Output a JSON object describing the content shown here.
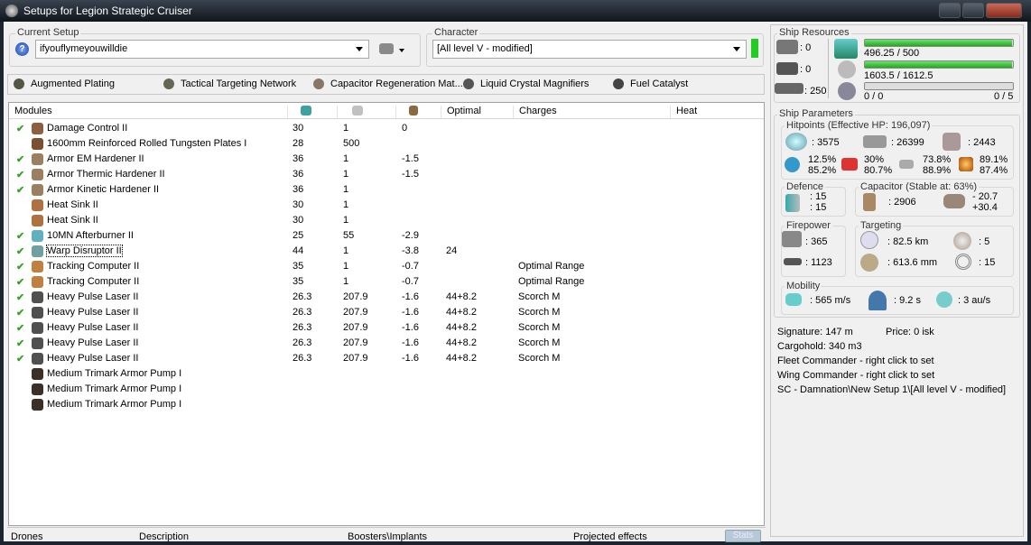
{
  "window": {
    "title": "Setups for Legion Strategic Cruiser"
  },
  "setup": {
    "label": "Current Setup",
    "value": "ifyouflymeyouwilldie"
  },
  "character": {
    "label": "Character",
    "value": "[All level V - modified]",
    "status_color": "#22cc22"
  },
  "subsystems": [
    "Augmented Plating",
    "Tactical Targeting Network",
    "Capacitor Regeneration Mat...",
    "Liquid Crystal Magnifiers",
    "Fuel Catalyst"
  ],
  "modules": {
    "headers": {
      "name": "Modules",
      "optimal": "Optimal",
      "charges": "Charges",
      "heat": "Heat"
    },
    "rows": [
      {
        "on": true,
        "name": "Damage Control II",
        "cpu": "30",
        "pg": "1",
        "cap": "0",
        "optimal": "",
        "charge": "",
        "icon": "#8a6040"
      },
      {
        "on": false,
        "name": "1600mm Reinforced Rolled Tungsten Plates I",
        "cpu": "28",
        "pg": "500",
        "cap": "",
        "optimal": "",
        "charge": "",
        "icon": "#7a5030"
      },
      {
        "on": true,
        "name": "Armor EM Hardener II",
        "cpu": "36",
        "pg": "1",
        "cap": "-1.5",
        "optimal": "",
        "charge": "",
        "icon": "#9a8060"
      },
      {
        "on": true,
        "name": "Armor Thermic Hardener II",
        "cpu": "36",
        "pg": "1",
        "cap": "-1.5",
        "optimal": "",
        "charge": "",
        "icon": "#9a8060"
      },
      {
        "on": true,
        "name": "Armor Kinetic Hardener II",
        "cpu": "36",
        "pg": "1",
        "cap": "",
        "optimal": "",
        "charge": "",
        "icon": "#9a8060"
      },
      {
        "on": false,
        "name": "Heat Sink II",
        "cpu": "30",
        "pg": "1",
        "cap": "",
        "optimal": "",
        "charge": "",
        "icon": "#b07040"
      },
      {
        "on": false,
        "name": "Heat Sink II",
        "cpu": "30",
        "pg": "1",
        "cap": "",
        "optimal": "",
        "charge": "",
        "icon": "#b07040"
      },
      {
        "on": true,
        "name": "10MN Afterburner II",
        "cpu": "25",
        "pg": "55",
        "cap": "-2.9",
        "optimal": "",
        "charge": "",
        "icon": "#60b0c0"
      },
      {
        "on": true,
        "name": "Warp Disruptor II",
        "cpu": "44",
        "pg": "1",
        "cap": "-3.8",
        "optimal": "24",
        "charge": "",
        "icon": "#70a0a0"
      },
      {
        "on": true,
        "name": "Tracking Computer II",
        "cpu": "35",
        "pg": "1",
        "cap": "-0.7",
        "optimal": "",
        "charge": "Optimal Range",
        "icon": "#c08040"
      },
      {
        "on": true,
        "name": "Tracking Computer II",
        "cpu": "35",
        "pg": "1",
        "cap": "-0.7",
        "optimal": "",
        "charge": "Optimal Range",
        "icon": "#c08040"
      },
      {
        "on": true,
        "name": "Heavy Pulse Laser II",
        "cpu": "26.3",
        "pg": "207.9",
        "cap": "-1.6",
        "optimal": "44+8.2",
        "charge": "Scorch M",
        "icon": "#505050"
      },
      {
        "on": true,
        "name": "Heavy Pulse Laser II",
        "cpu": "26.3",
        "pg": "207.9",
        "cap": "-1.6",
        "optimal": "44+8.2",
        "charge": "Scorch M",
        "icon": "#505050"
      },
      {
        "on": true,
        "name": "Heavy Pulse Laser II",
        "cpu": "26.3",
        "pg": "207.9",
        "cap": "-1.6",
        "optimal": "44+8.2",
        "charge": "Scorch M",
        "icon": "#505050"
      },
      {
        "on": true,
        "name": "Heavy Pulse Laser II",
        "cpu": "26.3",
        "pg": "207.9",
        "cap": "-1.6",
        "optimal": "44+8.2",
        "charge": "Scorch M",
        "icon": "#505050"
      },
      {
        "on": true,
        "name": "Heavy Pulse Laser II",
        "cpu": "26.3",
        "pg": "207.9",
        "cap": "-1.6",
        "optimal": "44+8.2",
        "charge": "Scorch M",
        "icon": "#505050"
      },
      {
        "on": false,
        "name": "Medium Trimark Armor Pump I",
        "cpu": "",
        "pg": "",
        "cap": "",
        "optimal": "",
        "charge": "",
        "icon": "#3a3028"
      },
      {
        "on": false,
        "name": "Medium Trimark Armor Pump I",
        "cpu": "",
        "pg": "",
        "cap": "",
        "optimal": "",
        "charge": "",
        "icon": "#3a3028"
      },
      {
        "on": false,
        "name": "Medium Trimark Armor Pump I",
        "cpu": "",
        "pg": "",
        "cap": "",
        "optimal": "",
        "charge": "",
        "icon": "#3a3028"
      }
    ]
  },
  "bottom_tabs": {
    "drones": "Drones",
    "description": "Description",
    "boosters": "Boosters\\Implants",
    "projected": "Projected effects",
    "stats": "Stats"
  },
  "resources": {
    "label": "Ship Resources",
    "turrets": ": 0",
    "launchers": ": 0",
    "drone_bay": ": 250",
    "cpu": {
      "text": "496.25 / 500",
      "fraction": 0.9925
    },
    "pg": {
      "text": "1603.5 / 1612.5",
      "fraction": 0.9944
    },
    "drone_bw": {
      "text": "0 / 0",
      "fraction": 0,
      "drones": "0 / 5"
    }
  },
  "params": {
    "label": "Ship Parameters",
    "hitpoints": {
      "label": "Hitpoints (Effective HP: 196,097)",
      "shield": ": 3575",
      "armor": ": 26399",
      "structure": ": 2443",
      "em": [
        "12.5%",
        "85.2%"
      ],
      "thermal": [
        "30%",
        "80.7%"
      ],
      "kinetic": [
        "73.8%",
        "88.9%"
      ],
      "explosive": [
        "89.1%",
        "87.4%"
      ]
    },
    "defence": {
      "label": "Defence",
      "a": ": 15",
      "b": ": 15"
    },
    "capacitor": {
      "label": "Capacitor (Stable at: 63%)",
      "amount": ": 2906",
      "use": "- 20.7",
      "regen": "+30.4"
    },
    "firepower": {
      "label": "Firepower",
      "dps": ": 365",
      "volley": ": 1123"
    },
    "targeting": {
      "label": "Targeting",
      "range": ": 82.5 km",
      "sensor": ": 613.6 mm",
      "targets": ": 5",
      "scan": ": 15"
    },
    "mobility": {
      "label": "Mobility",
      "speed": ": 565 m/s",
      "align": ": 9.2 s",
      "warp": ": 3 au/s"
    }
  },
  "info": {
    "signature": "Signature: 147 m",
    "price": "Price: 0 isk",
    "cargo": "Cargohold: 340 m3",
    "fleet": "Fleet Commander - right click to set",
    "wing": "Wing Commander - right click to set",
    "path": "SC - Damnation\\New Setup 1\\[All level V - modified]"
  }
}
